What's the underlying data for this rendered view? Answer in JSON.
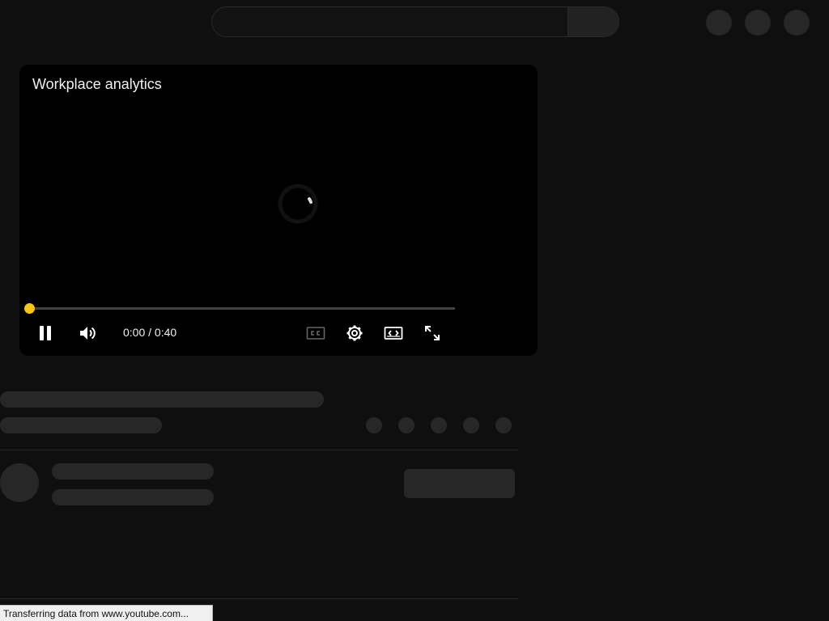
{
  "player": {
    "title": "Workplace analytics",
    "time_current": "0:00",
    "time_total": "0:40",
    "progress": 0.0,
    "accent_color": "#f5c518",
    "controls": [
      {
        "name": "pause-button",
        "icon": "pause-icon"
      },
      {
        "name": "volume-button",
        "icon": "volume-icon"
      },
      {
        "name": "captions-button",
        "icon": "cc-icon"
      },
      {
        "name": "settings-button",
        "icon": "gear-icon"
      },
      {
        "name": "theater-mode-button",
        "icon": "theater-icon"
      },
      {
        "name": "fullscreen-button",
        "icon": "fullscreen-icon"
      }
    ]
  },
  "status_bar": {
    "text": "Transferring data from www.youtube.com..."
  }
}
